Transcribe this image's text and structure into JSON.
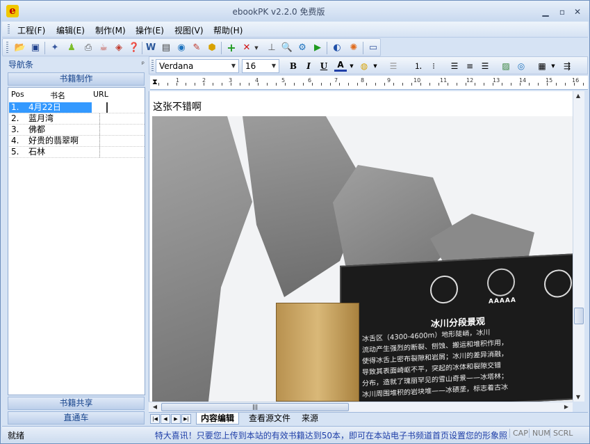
{
  "window": {
    "title": "ebookPK v2.2.0  免费版",
    "app_icon": "e"
  },
  "menu": [
    {
      "label": "工程(F)"
    },
    {
      "label": "编辑(E)"
    },
    {
      "label": "制作(M)"
    },
    {
      "label": "操作(E)"
    },
    {
      "label": "视图(V)"
    },
    {
      "label": "帮助(H)"
    }
  ],
  "nav": {
    "title": "导航条",
    "pin": "ᵖ",
    "section_top": "书籍制作",
    "columns": {
      "pos": "Pos",
      "name": "书名",
      "url": "URL"
    },
    "rows": [
      {
        "pos": "1.",
        "name": "4月22日"
      },
      {
        "pos": "2.",
        "name": "蓝月湾"
      },
      {
        "pos": "3.",
        "name": "佛都"
      },
      {
        "pos": "4.",
        "name": "好贵的翡翠啊"
      },
      {
        "pos": "5.",
        "name": "石林"
      }
    ],
    "section_share": "书籍共享",
    "section_express": "直通车"
  },
  "format": {
    "font": "Verdana",
    "size": "16"
  },
  "ruler": {
    "numbers": [
      "1",
      "2",
      "3",
      "4",
      "5",
      "6",
      "7",
      "8",
      "9",
      "10",
      "11",
      "12",
      "13",
      "14",
      "15",
      "16"
    ]
  },
  "editor": {
    "title": "这张不错啊"
  },
  "photo_sign": {
    "title": "冰川分段景观",
    "rating": "AAAAA",
    "lines": [
      "冰舌区（4300-4600m）地形陡峭，冰川",
      "流动产生强烈的断裂、刨蚀、搬运和堆积作用，",
      "使得冰舌上密布裂隙和岩屑；冰川的差异消融，",
      "导致其表面崎岖不平，突起的冰体和裂隙交错",
      "分布，造就了瑰丽罕见的雪山奇景——冰塔林；",
      "冰川周围堆积的岩块堆——冰碛垄，标志着古冰"
    ]
  },
  "hscroll": {
    "grip": "|||"
  },
  "tabs": [
    {
      "label": "内容编辑"
    },
    {
      "label": "查看源文件"
    },
    {
      "label": "来源"
    }
  ],
  "status": {
    "left": "就绪",
    "message": "特大喜讯！只要您上传到本站的有效书籍达到50本，即可在本站电子书频道首页设置您的形象照",
    "cap": "CAP",
    "num": "NUM",
    "scrl": "SCRL"
  },
  "toolbar_icons": [
    "open-folder-icon",
    "save-icon",
    "wand-icon",
    "android-icon",
    "print-icon",
    "java-icon",
    "pdf-icon",
    "help-page-icon",
    "word-icon",
    "document-icon",
    "ie-icon",
    "eraser-icon",
    "chm-icon",
    "add-icon",
    "delete-icon",
    "ruler-icon",
    "search-icon",
    "settings-icon",
    "play-icon",
    "help-icon",
    "web-icon",
    "info-icon"
  ],
  "colors": {
    "accent": "#15428b",
    "selection": "#3399ff",
    "status_message": "#1f3fa8"
  }
}
